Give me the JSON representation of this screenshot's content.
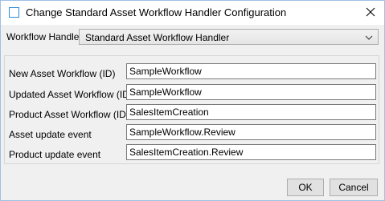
{
  "window": {
    "title": "Change Standard Asset Workflow Handler Configuration",
    "close_icon": "close-icon"
  },
  "workflow_handler": {
    "label": "Workflow Handler",
    "selected": "Standard Asset Workflow Handler",
    "arrow_icon": "chevron-down-icon"
  },
  "fields": [
    {
      "label": "New Asset Workflow (ID)",
      "value": "SampleWorkflow"
    },
    {
      "label": "Updated Asset Workflow (ID)",
      "value": "SampleWorkflow"
    },
    {
      "label": "Product Asset Workflow (ID)",
      "value": "SalesItemCreation"
    },
    {
      "label": "Asset update event",
      "value": "SampleWorkflow.Review"
    },
    {
      "label": "Product update event",
      "value": "SalesItemCreation.Review"
    }
  ],
  "buttons": {
    "ok": "OK",
    "cancel": "Cancel"
  }
}
